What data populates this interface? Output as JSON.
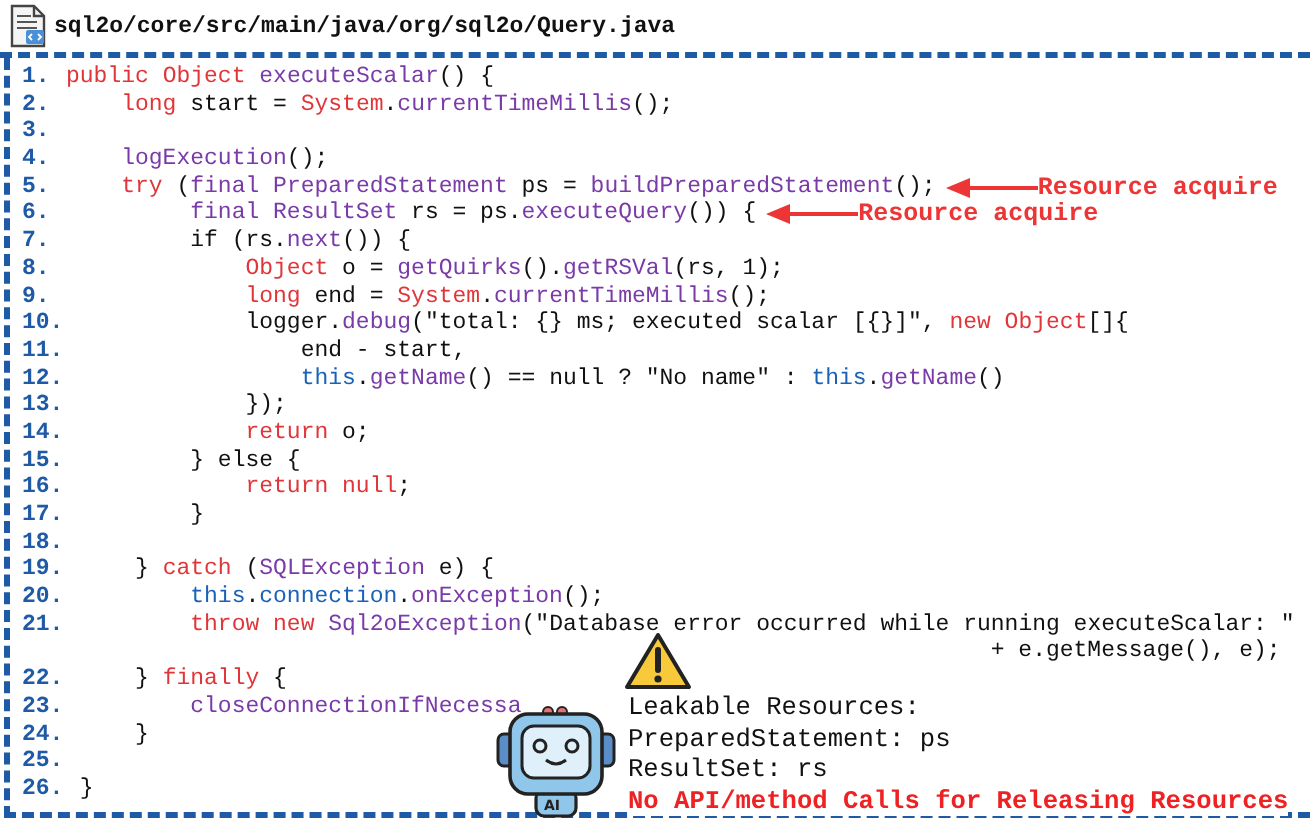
{
  "file": {
    "path": "sql2o/core/src/main/java/org/sql2o/Query.java"
  },
  "lines": [
    {
      "num": "1.",
      "tokens": [
        {
          "t": "public",
          "color": "#e0363a"
        },
        {
          "t": " Object",
          "color": "#e0363a"
        },
        {
          "t": " executeScalar",
          "color": "#7a3aa8"
        },
        {
          "t": "() {"
        }
      ]
    },
    {
      "num": "2.",
      "tokens": [
        {
          "t": "    long",
          "color": "#e0363a"
        },
        {
          "t": " start = "
        },
        {
          "t": "System",
          "color": "#e0363a"
        },
        {
          "t": "."
        },
        {
          "t": "currentTimeMillis",
          "color": "#7a3aa8"
        },
        {
          "t": "();"
        }
      ]
    },
    {
      "num": "3."
    },
    {
      "num": "4.",
      "tokens": [
        {
          "t": "    logExecution",
          "color": "#7a3aa8"
        },
        {
          "t": "();"
        }
      ]
    },
    {
      "num": "5.",
      "tokens": [
        {
          "t": "    try",
          "color": "#e0363a"
        },
        {
          "t": " ("
        },
        {
          "t": "final",
          "color": "#7a3aa8"
        },
        {
          "t": " PreparedStatement",
          "color": "#7a3aa8"
        },
        {
          "t": " ps = "
        },
        {
          "t": "buildPreparedStatement",
          "color": "#7a3aa8"
        },
        {
          "t": "();"
        }
      ],
      "annotation": "Resource acquire"
    },
    {
      "num": "6.",
      "tokens": [
        {
          "t": "         final",
          "color": "#7a3aa8"
        },
        {
          "t": " ResultSet",
          "color": "#7a3aa8"
        },
        {
          "t": " rs = ps."
        },
        {
          "t": "executeQuery",
          "color": "#7a3aa8"
        },
        {
          "t": "()) {"
        }
      ],
      "annotation": "Resource acquire"
    },
    {
      "num": "7.",
      "tokens": [
        {
          "t": "         if (rs."
        },
        {
          "t": "next",
          "color": "#7a3aa8"
        },
        {
          "t": "()) {"
        }
      ]
    },
    {
      "num": "8.",
      "tokens": [
        {
          "t": "             Object",
          "color": "#e0363a"
        },
        {
          "t": " o = "
        },
        {
          "t": "getQuirks",
          "color": "#7a3aa8"
        },
        {
          "t": "()."
        },
        {
          "t": "getRSVal",
          "color": "#7a3aa8"
        },
        {
          "t": "(rs, 1);"
        }
      ]
    },
    {
      "num": "9.",
      "tokens": [
        {
          "t": "             long",
          "color": "#e0363a"
        },
        {
          "t": " end = "
        },
        {
          "t": "System",
          "color": "#e0363a"
        },
        {
          "t": "."
        },
        {
          "t": "currentTimeMillis",
          "color": "#7a3aa8"
        },
        {
          "t": "();"
        }
      ]
    },
    {
      "num": "10.",
      "tokens": [
        {
          "t": "             logger."
        },
        {
          "t": "debug",
          "color": "#7a3aa8"
        },
        {
          "t": "(\"total: {} ms; executed scalar [{}]\", "
        },
        {
          "t": "new Object",
          "color": "#e0363a"
        },
        {
          "t": "[]{"
        }
      ]
    },
    {
      "num": "11.",
      "tokens": [
        {
          "t": "                 end - start,"
        }
      ]
    },
    {
      "num": "12.",
      "tokens": [
        {
          "t": "                 this",
          "color": "#1a62b8"
        },
        {
          "t": "."
        },
        {
          "t": "getName",
          "color": "#7a3aa8"
        },
        {
          "t": "() == null ? \"No name\" : "
        },
        {
          "t": "this",
          "color": "#1a62b8"
        },
        {
          "t": "."
        },
        {
          "t": "getName",
          "color": "#7a3aa8"
        },
        {
          "t": "()"
        }
      ]
    },
    {
      "num": "13.",
      "tokens": [
        {
          "t": "             });"
        }
      ]
    },
    {
      "num": "14.",
      "tokens": [
        {
          "t": "             return",
          "color": "#e0363a"
        },
        {
          "t": " o;"
        }
      ]
    },
    {
      "num": "15.",
      "tokens": [
        {
          "t": "         } else {"
        }
      ]
    },
    {
      "num": "16.",
      "tokens": [
        {
          "t": "             return null",
          "color": "#e0363a"
        },
        {
          "t": ";"
        }
      ]
    },
    {
      "num": "17.",
      "tokens": [
        {
          "t": "         }"
        }
      ]
    },
    {
      "num": "18."
    },
    {
      "num": "19.",
      "tokens": [
        {
          "t": "     }"
        },
        {
          "t": " catch",
          "color": "#e0363a"
        },
        {
          "t": " ("
        },
        {
          "t": "SQLException",
          "color": "#7a3aa8"
        },
        {
          "t": " e) {"
        }
      ]
    },
    {
      "num": "20.",
      "tokens": [
        {
          "t": "         this",
          "color": "#1a62b8"
        },
        {
          "t": "."
        },
        {
          "t": "connection",
          "color": "#1a62b8"
        },
        {
          "t": "."
        },
        {
          "t": "onException",
          "color": "#7a3aa8"
        },
        {
          "t": "();"
        }
      ]
    },
    {
      "num": "21.",
      "tokens": [
        {
          "t": "         throw new",
          "color": "#e0363a"
        },
        {
          "t": " Sql2oException",
          "color": "#7a3aa8"
        },
        {
          "t": "(\"Database error occurred while running executeScalar: \""
        }
      ]
    },
    {
      "tokens": [
        {
          "t": "                                                                   + e.getMessage(), e);"
        }
      ]
    },
    {
      "num": "22.",
      "tokens": [
        {
          "t": "     }"
        },
        {
          "t": " finally",
          "color": "#e0363a"
        },
        {
          "t": " {"
        }
      ]
    },
    {
      "num": "23.",
      "tokens": [
        {
          "t": "         closeConnectionIfNecessa",
          "color": "#7a3aa8"
        }
      ]
    },
    {
      "num": "24.",
      "tokens": [
        {
          "t": "     }"
        }
      ]
    },
    {
      "num": "25."
    },
    {
      "num": "26.",
      "tokens": [
        {
          "t": " }"
        }
      ]
    }
  ],
  "leak_report": {
    "robot_label": "AI",
    "title": "Leakable Resources:",
    "items": [
      "PreparedStatement: ps",
      "ResultSet: rs"
    ],
    "warning": "No API/method Calls for Releasing Resources"
  }
}
